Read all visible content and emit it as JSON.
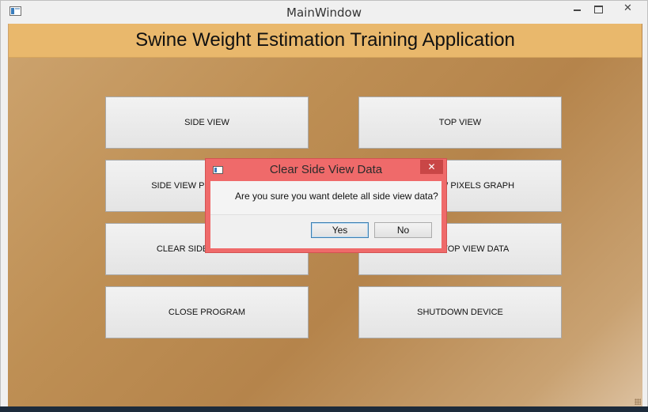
{
  "window": {
    "title": "MainWindow",
    "controls": {
      "minimize": "minimize-icon",
      "maximize": "maximize-icon",
      "close": "close-icon",
      "close_glyph": "✕"
    }
  },
  "header": {
    "title": "Swine Weight Estimation Training Application"
  },
  "buttons": {
    "side_view": "SIDE VIEW",
    "top_view": "TOP VIEW",
    "side_view_pixels_graph": "SIDE VIEW PIXELS GRAPH",
    "top_view_pixels_graph": "TOP VIEW PIXELS GRAPH",
    "clear_side_view_data": "CLEAR SIDE VIEW DATA",
    "clear_top_view_data": "CLEAR TOP VIEW DATA",
    "close_program": "CLOSE PROGRAM",
    "shutdown_device": "SHUTDOWN DEVICE"
  },
  "dialog": {
    "title": "Clear Side View Data",
    "message": "Are you sure you want delete all side view data?",
    "yes_label": "Yes",
    "no_label": "No",
    "close_glyph": "✕"
  },
  "colors": {
    "header_band": "#e9b86c",
    "dialog_frame": "#ef6a6a",
    "background": "#be8f54"
  }
}
